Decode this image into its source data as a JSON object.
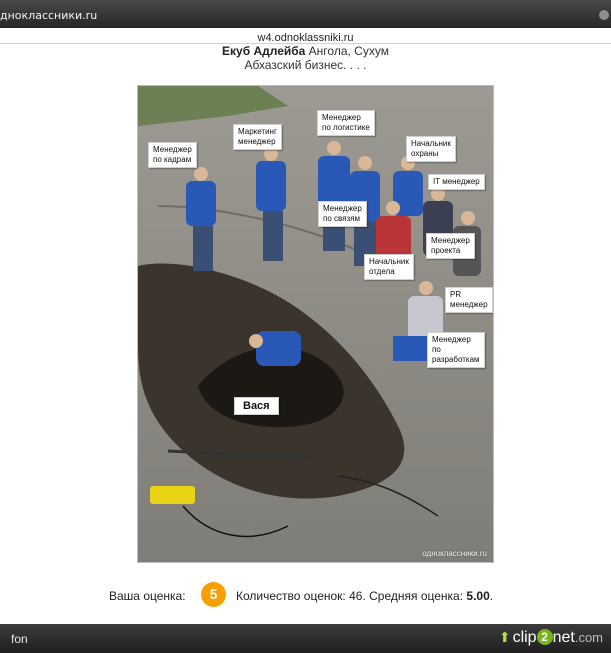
{
  "browser": {
    "tab_title": "дноклассники.ru",
    "url": "w4.odnoklassniki.ru"
  },
  "header": {
    "user_name": "Екуб Адлейба",
    "location": " Ангола, Сухум",
    "caption": "Абхазский бизнес. . . ."
  },
  "photo": {
    "labels": {
      "hr": "Менеджер\nпо кадрам",
      "marketing": "Маркетинг\nменеджер",
      "logistics": "Менеджер\nпо логистике",
      "security": "Начальник\nохраны",
      "it": "IT менеджер",
      "relations": "Менеджер\nпо связям",
      "project": "Менеджер\nпроекта",
      "dept_head": "Начальник\nотдела",
      "pr": "PR\nменеджер",
      "dev": "Менеджер\nпо\nразработкам",
      "vasya": "Вася"
    },
    "watermark": "одноклассники.ru"
  },
  "rating": {
    "your_label": "Ваша оценка:",
    "your_value": "5",
    "count_label": "Количество оценок: ",
    "count_value": "46",
    "avg_label": ". Средняя оценка: ",
    "avg_value": "5.00",
    "end": ".",
    "badge_color": "#f7a000"
  },
  "statusbar": {
    "left_text": "fon",
    "logo_prefix": "clip",
    "logo_mid": "2",
    "logo_suffix": "net",
    "logo_domain": ".com"
  }
}
